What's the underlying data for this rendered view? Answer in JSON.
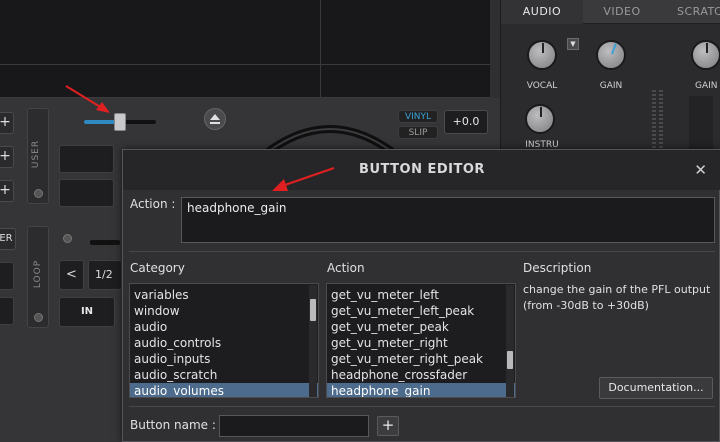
{
  "deck": {
    "plus_label": "+",
    "user_label": "USER",
    "loop_label": "LOOP",
    "er_label": "ER",
    "vinyl_label": "VINYL",
    "slip_label": "SLIP",
    "pitch_value": "+0.0",
    "in_label": "IN",
    "loop_size": "1/2",
    "prev_label": "<",
    "pitch_slider_level_pct": 45
  },
  "mixer": {
    "tabs": [
      {
        "label": "AUDIO"
      },
      {
        "label": "VIDEO"
      },
      {
        "label": "SCRATCH"
      }
    ],
    "knobs": {
      "vocal": "VOCAL",
      "instru": "INSTRU",
      "gain1": "GAIN",
      "gain2": "GAIN"
    }
  },
  "dialog": {
    "title": "BUTTON EDITOR",
    "close_glyph": "✕",
    "action_label": "Action :",
    "action_value": "headphone_gain",
    "category_header": "Category",
    "action_header": "Action",
    "description_header": "Description",
    "categories": [
      "variables",
      "window",
      "audio",
      "audio_controls",
      "audio_inputs",
      "audio_scratch",
      "audio_volumes"
    ],
    "selected_category_index": 6,
    "actions": [
      "get_vu_meter_left",
      "get_vu_meter_left_peak",
      "get_vu_meter_peak",
      "get_vu_meter_right",
      "get_vu_meter_right_peak",
      "headphone_crossfader",
      "headphone_gain"
    ],
    "selected_action_index": 6,
    "description": "change the gain of the PFL output (from -30dB to +30dB)",
    "documentation_label": "Documentation...",
    "button_name_label": "Button name :",
    "button_name_value": "",
    "add_label": "+"
  },
  "colors": {
    "selection": "#4d6b8c",
    "arrow": "#e02020",
    "pitch_fill": "#2f8bbf",
    "knob_indicator": "#3aa0d8"
  }
}
